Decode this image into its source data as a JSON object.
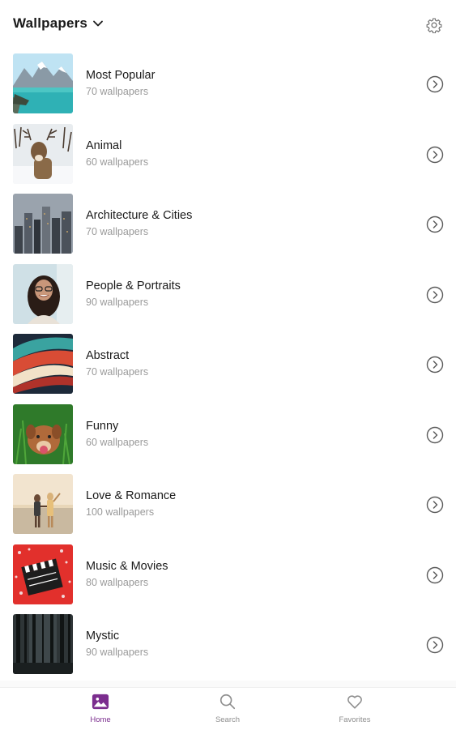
{
  "header": {
    "title": "Wallpapers",
    "icons": {
      "dropdown": "chevron-down-icon",
      "settings": "gear-icon"
    }
  },
  "categories": [
    {
      "name": "Most Popular",
      "count": "70 wallpapers",
      "thumb": "lake-mountains"
    },
    {
      "name": "Animal",
      "count": "60 wallpapers",
      "thumb": "deer-snow"
    },
    {
      "name": "Architecture & Cities",
      "count": "70 wallpapers",
      "thumb": "city-skyline"
    },
    {
      "name": "People & Portraits",
      "count": "90 wallpapers",
      "thumb": "woman-portrait"
    },
    {
      "name": "Abstract",
      "count": "70 wallpapers",
      "thumb": "abstract-paint"
    },
    {
      "name": "Funny",
      "count": "60 wallpapers",
      "thumb": "dog-grass"
    },
    {
      "name": "Love & Romance",
      "count": "100 wallpapers",
      "thumb": "couple-beach"
    },
    {
      "name": "Music & Movies",
      "count": "80 wallpapers",
      "thumb": "clapperboard"
    },
    {
      "name": "Mystic",
      "count": "90 wallpapers",
      "thumb": "dark-forest"
    }
  ],
  "nav": {
    "items": [
      {
        "label": "Home",
        "icon": "image-icon",
        "active": true
      },
      {
        "label": "Search",
        "icon": "search-icon",
        "active": false
      },
      {
        "label": "Favorites",
        "icon": "heart-icon",
        "active": false
      }
    ]
  },
  "colors": {
    "accent": "#7b2d8e",
    "muted": "#9a9a9a",
    "text": "#1a1a1a"
  }
}
